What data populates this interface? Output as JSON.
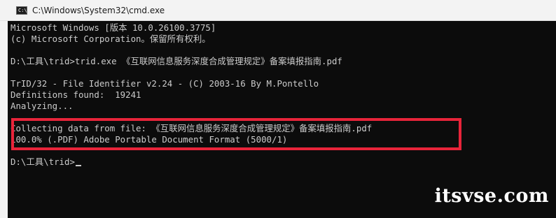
{
  "window": {
    "title": "C:\\Windows\\System32\\cmd.exe",
    "icon": "cmd-icon",
    "icon_glyph": "C:\\"
  },
  "console": {
    "lines": [
      "Microsoft Windows [版本 10.0.26100.3775]",
      "(c) Microsoft Corporation。保留所有权利。",
      "",
      "D:\\工具\\trid>trid.exe 《互联网信息服务深度合成管理规定》备案填报指南.pdf",
      "",
      "TrID/32 - File Identifier v2.24 - (C) 2003-16 By M.Pontello",
      "Definitions found:  19241",
      "Analyzing...",
      "",
      "Collecting data from file: 《互联网信息服务深度合成管理规定》备案填报指南.pdf",
      "100.0% (.PDF) Adobe Portable Document Format (5000/1)",
      "",
      "D:\\工具\\trid>"
    ],
    "highlight_color": "#e8243a",
    "background_color": "#0c0c0c",
    "text_color": "#cccccc"
  },
  "watermark": {
    "text": "itsvse.com"
  }
}
